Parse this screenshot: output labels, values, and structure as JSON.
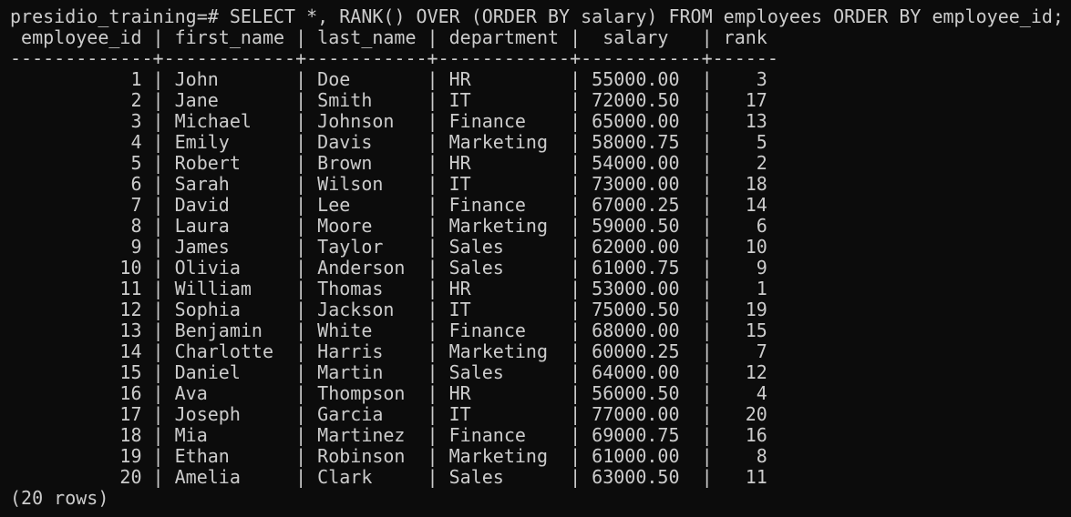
{
  "prompt": "presidio_training=#",
  "query": "SELECT *, RANK() OVER (ORDER BY salary) FROM employees ORDER BY employee_id;",
  "header_line": " employee_id | first_name | last_name | department |  salary   | rank",
  "divider_line": "-------------+------------+-----------+------------+-----------+------",
  "rows": [
    "           1 | John       | Doe       | HR         | 55000.00  |    3",
    "           2 | Jane       | Smith     | IT         | 72000.50  |   17",
    "           3 | Michael    | Johnson   | Finance    | 65000.00  |   13",
    "           4 | Emily      | Davis     | Marketing  | 58000.75  |    5",
    "           5 | Robert     | Brown     | HR         | 54000.00  |    2",
    "           6 | Sarah      | Wilson    | IT         | 73000.00  |   18",
    "           7 | David      | Lee       | Finance    | 67000.25  |   14",
    "           8 | Laura      | Moore     | Marketing  | 59000.50  |    6",
    "           9 | James      | Taylor    | Sales      | 62000.00  |   10",
    "          10 | Olivia     | Anderson  | Sales      | 61000.75  |    9",
    "          11 | William    | Thomas    | HR         | 53000.00  |    1",
    "          12 | Sophia     | Jackson   | IT         | 75000.50  |   19",
    "          13 | Benjamin   | White     | Finance    | 68000.00  |   15",
    "          14 | Charlotte  | Harris    | Marketing  | 60000.25  |    7",
    "          15 | Daniel     | Martin    | Sales      | 64000.00  |   12",
    "          16 | Ava        | Thompson  | HR         | 56000.50  |    4",
    "          17 | Joseph     | Garcia    | IT         | 77000.00  |   20",
    "          18 | Mia        | Martinez  | Finance    | 69000.75  |   16",
    "          19 | Ethan      | Robinson  | Marketing  | 61000.00  |    8",
    "          20 | Amelia     | Clark     | Sales      | 63000.50  |   11"
  ],
  "footer": "(20 rows)",
  "colors": {
    "background": "#0c0c0c",
    "text": "#cccccc"
  }
}
